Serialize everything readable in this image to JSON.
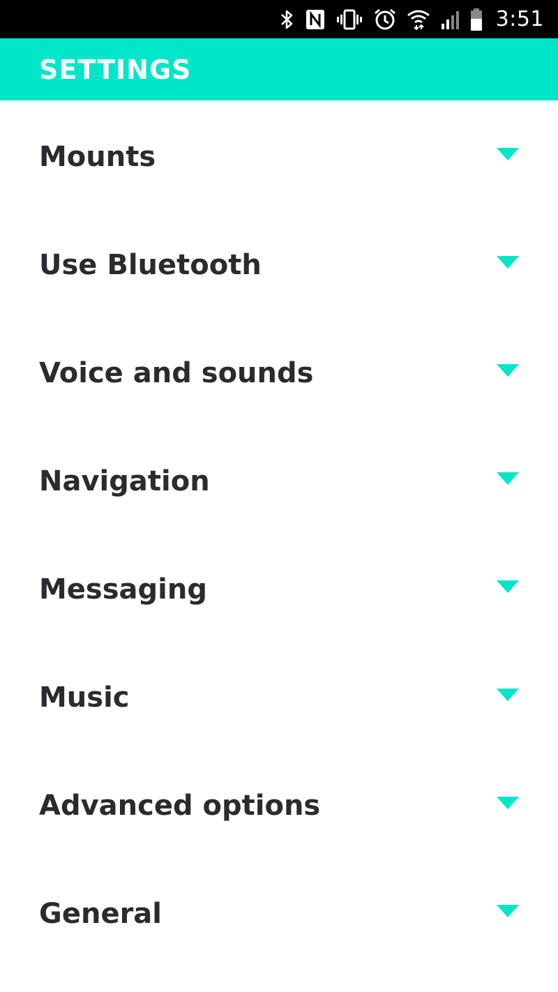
{
  "status_bar": {
    "time": "3:51",
    "icons": [
      "bluetooth-icon",
      "nfc-icon",
      "vibrate-icon",
      "alarm-icon",
      "wifi-icon",
      "signal-icon",
      "battery-icon"
    ]
  },
  "app_bar": {
    "title": "SETTINGS"
  },
  "colors": {
    "accent": "#00e6c8",
    "text": "#2b2b2f",
    "status_bar": "#000000"
  },
  "settings": {
    "items": [
      {
        "label": "Mounts"
      },
      {
        "label": "Use Bluetooth"
      },
      {
        "label": "Voice and sounds"
      },
      {
        "label": "Navigation"
      },
      {
        "label": "Messaging"
      },
      {
        "label": "Music"
      },
      {
        "label": "Advanced options"
      },
      {
        "label": "General"
      }
    ]
  }
}
